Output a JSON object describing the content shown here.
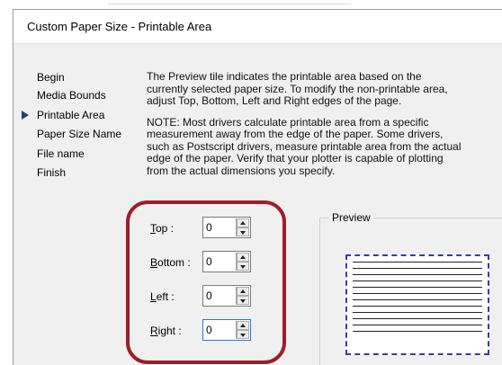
{
  "dialog": {
    "title": "Custom Paper Size - Printable Area"
  },
  "nav": {
    "items": [
      {
        "label": "Begin",
        "active": false
      },
      {
        "label": "Media Bounds",
        "active": false
      },
      {
        "label": "Printable Area",
        "active": true
      },
      {
        "label": "Paper Size Name",
        "active": false
      },
      {
        "label": "File name",
        "active": false
      },
      {
        "label": "Finish",
        "active": false
      }
    ]
  },
  "description": {
    "lines": [
      "The Preview tile indicates the printable area based on the",
      "currently selected paper size. To modify the non-printable area,",
      "adjust Top, Bottom, Left and Right edges of the page."
    ],
    "note_lines": [
      "NOTE: Most drivers calculate printable area from a specific",
      "measurement away from the edge of the paper. Some drivers,",
      "such as Postscript drivers, measure printable area from the actual",
      "edge of the paper. Verify that your plotter is capable of plotting",
      "from the actual dimensions you specify."
    ]
  },
  "fields": [
    {
      "label_first": "T",
      "label_rest": "op :",
      "value": "0"
    },
    {
      "label_first": "B",
      "label_rest": "ottom :",
      "value": "0"
    },
    {
      "label_first": "L",
      "label_rest": "eft :",
      "value": "0"
    },
    {
      "label_first": "R",
      "label_rest": "ight :",
      "value": "0"
    }
  ],
  "preview": {
    "label": "Preview"
  },
  "colors": {
    "callout": "#a01d2b",
    "nav_arrow": "#1f3f77",
    "paper_border": "#3a3aa8"
  }
}
